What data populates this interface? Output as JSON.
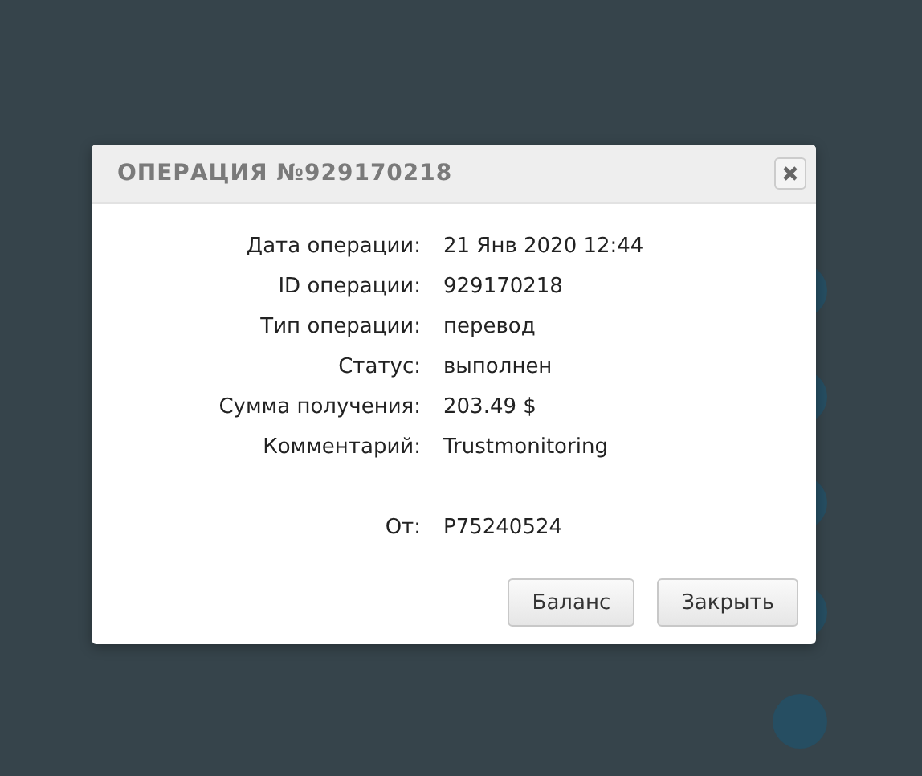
{
  "dialog": {
    "title": "ОПЕРАЦИЯ №929170218",
    "fields": [
      {
        "label": "Дата операции:",
        "value": "21 Янв 2020 12:44"
      },
      {
        "label": "ID операции:",
        "value": "929170218"
      },
      {
        "label": "Тип операции:",
        "value": "перевод"
      },
      {
        "label": "Статус:",
        "value": "выполнен"
      },
      {
        "label": "Сумма получения:",
        "value": "203.49 $"
      },
      {
        "label": "Комментарий:",
        "value": "Trustmonitoring"
      }
    ],
    "sender": {
      "label": "От:",
      "value": "P75240524"
    },
    "buttons": [
      "Баланс",
      "Закрыть"
    ]
  }
}
